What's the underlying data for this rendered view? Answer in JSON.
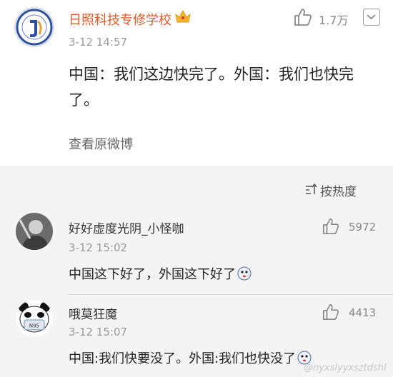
{
  "post": {
    "author": "日照科技专修学校",
    "time": "3-12 14:57",
    "text": "中国：我们这边快完了。外国：我们也快完了。",
    "likes": "1.7万",
    "view_original": "查看原微博"
  },
  "sort": {
    "label": "按热度"
  },
  "comments": [
    {
      "name": "好好虚度光阴_小怪咖",
      "time": "3-12 15:02",
      "text": "中国这下好了，外国这下好了",
      "likes": "5972"
    },
    {
      "name": "哦莫狂魔",
      "time": "3-12 15:07",
      "text": "中国:我们快要没了。外国:我们也快没了",
      "likes": "4413",
      "mask_text": "N95"
    }
  ],
  "watermark": "@nyxslyyxsztdshl",
  "colors": {
    "author": "#e05a2a",
    "background": "#f4f4f4"
  },
  "icons": [
    "school-logo-icon",
    "crown-icon",
    "thumbs-up-icon",
    "chevron-down-icon",
    "sort-icon",
    "emoji-icon"
  ]
}
